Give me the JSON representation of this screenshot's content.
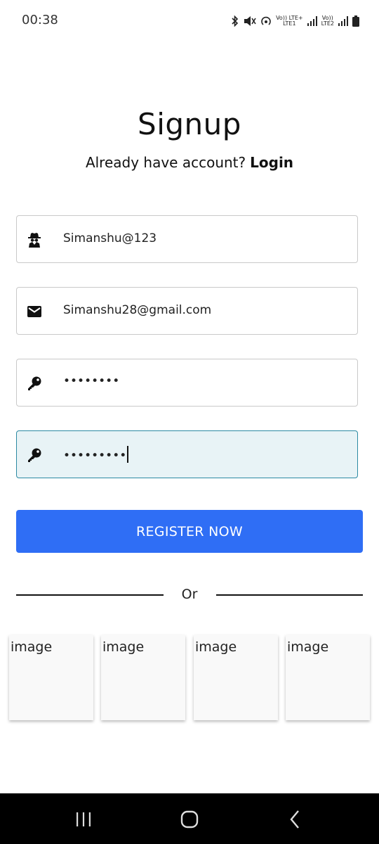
{
  "status_bar": {
    "time": "00:38",
    "network1_top": "Vo)) LTE+",
    "network1_bottom": "LTE1",
    "network2_top": "Vo))",
    "network2_bottom": "LTE2"
  },
  "header": {
    "title": "Signup",
    "prompt": "Already have account?",
    "login_label": "Login"
  },
  "form": {
    "username_value": "Simanshu@123",
    "email_value": "Simanshu28@gmail.com",
    "password_value": "••••••••",
    "confirm_password_value": "•••••••••",
    "username_icon": "spy-icon",
    "email_icon": "mail-icon",
    "password_icon": "key-icon"
  },
  "actions": {
    "register_label": "REGISTER NOW",
    "divider_label": "Or"
  },
  "social": {
    "items": [
      "image",
      "image",
      "image",
      "image"
    ]
  },
  "colors": {
    "primary_button": "#2f6ef5",
    "focused_field_bg": "#e8f3f6",
    "focused_field_border": "#2c8aa3"
  }
}
